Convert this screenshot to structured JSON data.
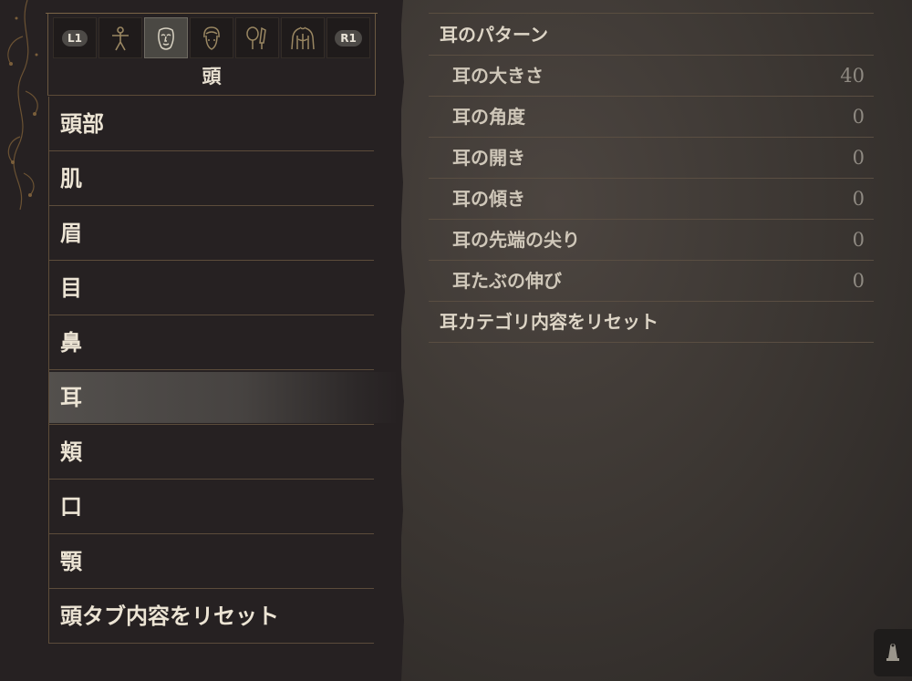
{
  "tabs": {
    "left_button": "L1",
    "right_button": "R1",
    "icons": [
      "body-figure-icon",
      "face-icon",
      "hair-icon",
      "cosmetics-icon",
      "torso-icon"
    ],
    "active_index": 1
  },
  "category_title": "頭",
  "menu": {
    "items": [
      "頭部",
      "肌",
      "眉",
      "目",
      "鼻",
      "耳",
      "頬",
      "口",
      "顎",
      "頭タブ内容をリセット"
    ],
    "selected_index": 5
  },
  "options": {
    "header": "耳のパターン",
    "sliders": [
      {
        "label": "耳の大きさ",
        "value": "40"
      },
      {
        "label": "耳の角度",
        "value": "0"
      },
      {
        "label": "耳の開き",
        "value": "0"
      },
      {
        "label": "耳の傾き",
        "value": "0"
      },
      {
        "label": "耳の先端の尖り",
        "value": "0"
      },
      {
        "label": "耳たぶの伸び",
        "value": "0"
      }
    ],
    "reset_label": "耳カテゴリ内容をリセット"
  },
  "colors": {
    "accent_line": "#5c4c3b",
    "text": "#ece4d4",
    "value_text": "#8f8a82"
  }
}
